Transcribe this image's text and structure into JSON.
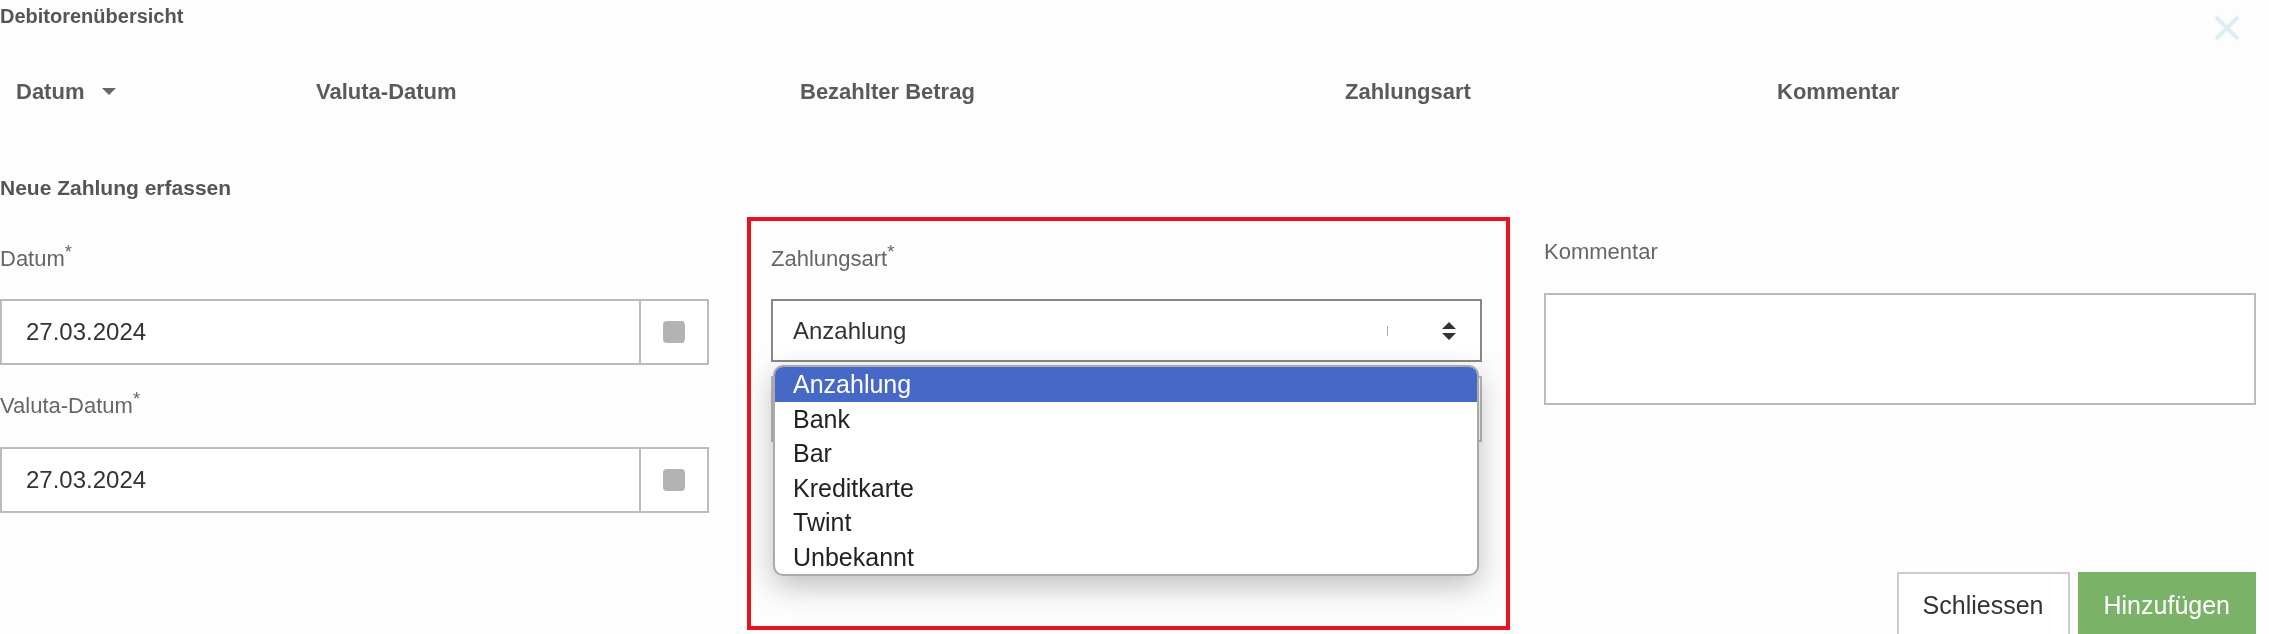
{
  "dialog": {
    "title": "Debitorenübersicht"
  },
  "table": {
    "columns": [
      {
        "label": "Datum",
        "sorted": true
      },
      {
        "label": "Valuta-Datum",
        "sorted": false
      },
      {
        "label": "Bezahlter Betrag",
        "sorted": false
      },
      {
        "label": "Zahlungsart",
        "sorted": false
      },
      {
        "label": "Kommentar",
        "sorted": false
      }
    ]
  },
  "new_payment": {
    "heading": "Neue Zahlung erfassen",
    "fields": [
      {
        "kind": "date",
        "label": "Datum$^{*}$",
        "value": "27.03.2024"
      },
      {
        "kind": "date",
        "label": "Valuta-Datum$^{*}$",
        "value": "27.03.2024"
      },
      {
        "kind": "select",
        "label": "Zahlungsart$^{*}$",
        "value": "Anzahlung",
        "expanded": true,
        "options": [
          {
            "label": "Anzahlung",
            "selected": true
          },
          {
            "label": "Bank",
            "selected": false
          },
          {
            "label": "Bar",
            "selected": false
          },
          {
            "label": "Kreditkarte",
            "selected": false
          },
          {
            "label": "Twint",
            "selected": false
          },
          {
            "label": "Unbekannt",
            "selected": false
          }
        ]
      },
      {
        "kind": "textarea",
        "label": "Kommentar"
      }
    ]
  },
  "buttons": [
    {
      "label": "Schliessen",
      "kind": "secondary"
    },
    {
      "label": "Hinzufügen",
      "kind": "primary"
    }
  ]
}
